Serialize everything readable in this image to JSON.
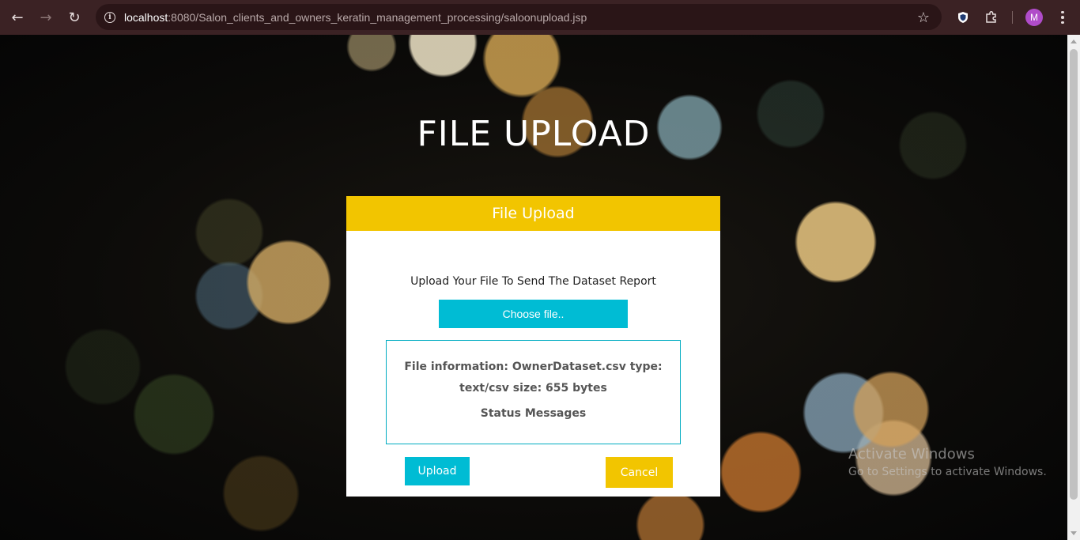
{
  "browser": {
    "url_host": "localhost",
    "url_rest": ":8080/Salon_clients_and_owners_keratin_management_processing/saloonupload.jsp",
    "profile_initial": "M",
    "icons": {
      "back": "back-arrow-icon",
      "forward": "forward-arrow-icon",
      "reload": "reload-icon",
      "site_info": "site-info-icon",
      "bookmark": "star-icon",
      "extension_shield": "shield-icon",
      "extensions": "puzzle-icon",
      "menu": "kebab-menu-icon"
    },
    "colors": {
      "chrome_bg": "#3b2224",
      "omnibox_bg": "#2a1517",
      "avatar_bg": "#b04cc9"
    }
  },
  "page": {
    "title": "FILE UPLOAD",
    "card": {
      "header": "File Upload",
      "prompt": "Upload Your File To Send The Dataset Report",
      "choose_button": "Choose file..",
      "file_info": "File information: OwnerDataset.csv type: text/csv size: 655 bytes",
      "status_messages": "Status Messages",
      "upload_button": "Upload",
      "cancel_button": "Cancel"
    },
    "colors": {
      "accent_yellow": "#f2c500",
      "accent_cyan": "#00bcd4"
    }
  },
  "watermark": {
    "title": "Activate Windows",
    "subtitle": "Go to Settings to activate Windows."
  }
}
